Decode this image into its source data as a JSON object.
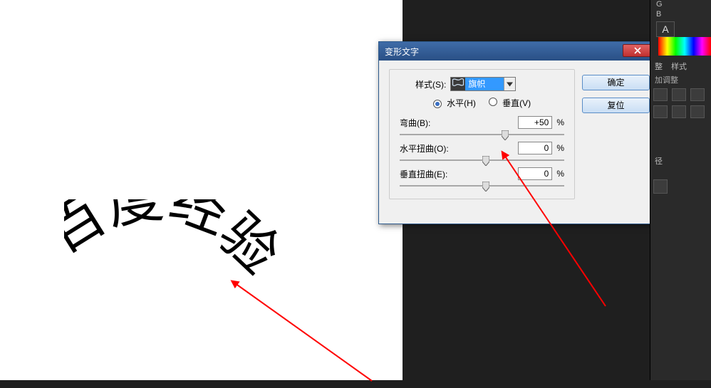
{
  "canvas": {
    "text": "百度经验"
  },
  "dialog": {
    "title": "变形文字",
    "style_label": "样式(S):",
    "style_value": "旗帜",
    "orient_h": "水平(H)",
    "orient_v": "垂直(V)",
    "sliders": {
      "bend": {
        "label": "弯曲(B):",
        "value": "+50",
        "unit": "%",
        "pos": 0.62
      },
      "hdist": {
        "label": "水平扭曲(O):",
        "value": "0",
        "unit": "%",
        "pos": 0.5
      },
      "vdist": {
        "label": "垂直扭曲(E):",
        "value": "0",
        "unit": "%",
        "pos": 0.5
      }
    },
    "ok": "确定",
    "reset": "复位"
  },
  "side": {
    "character_icon": "A",
    "rgb": {
      "g": "G",
      "b": "B"
    },
    "tabs": {
      "whole": "整",
      "style": "样式"
    },
    "add_adjust": "加调整",
    "channel_short": "径"
  }
}
